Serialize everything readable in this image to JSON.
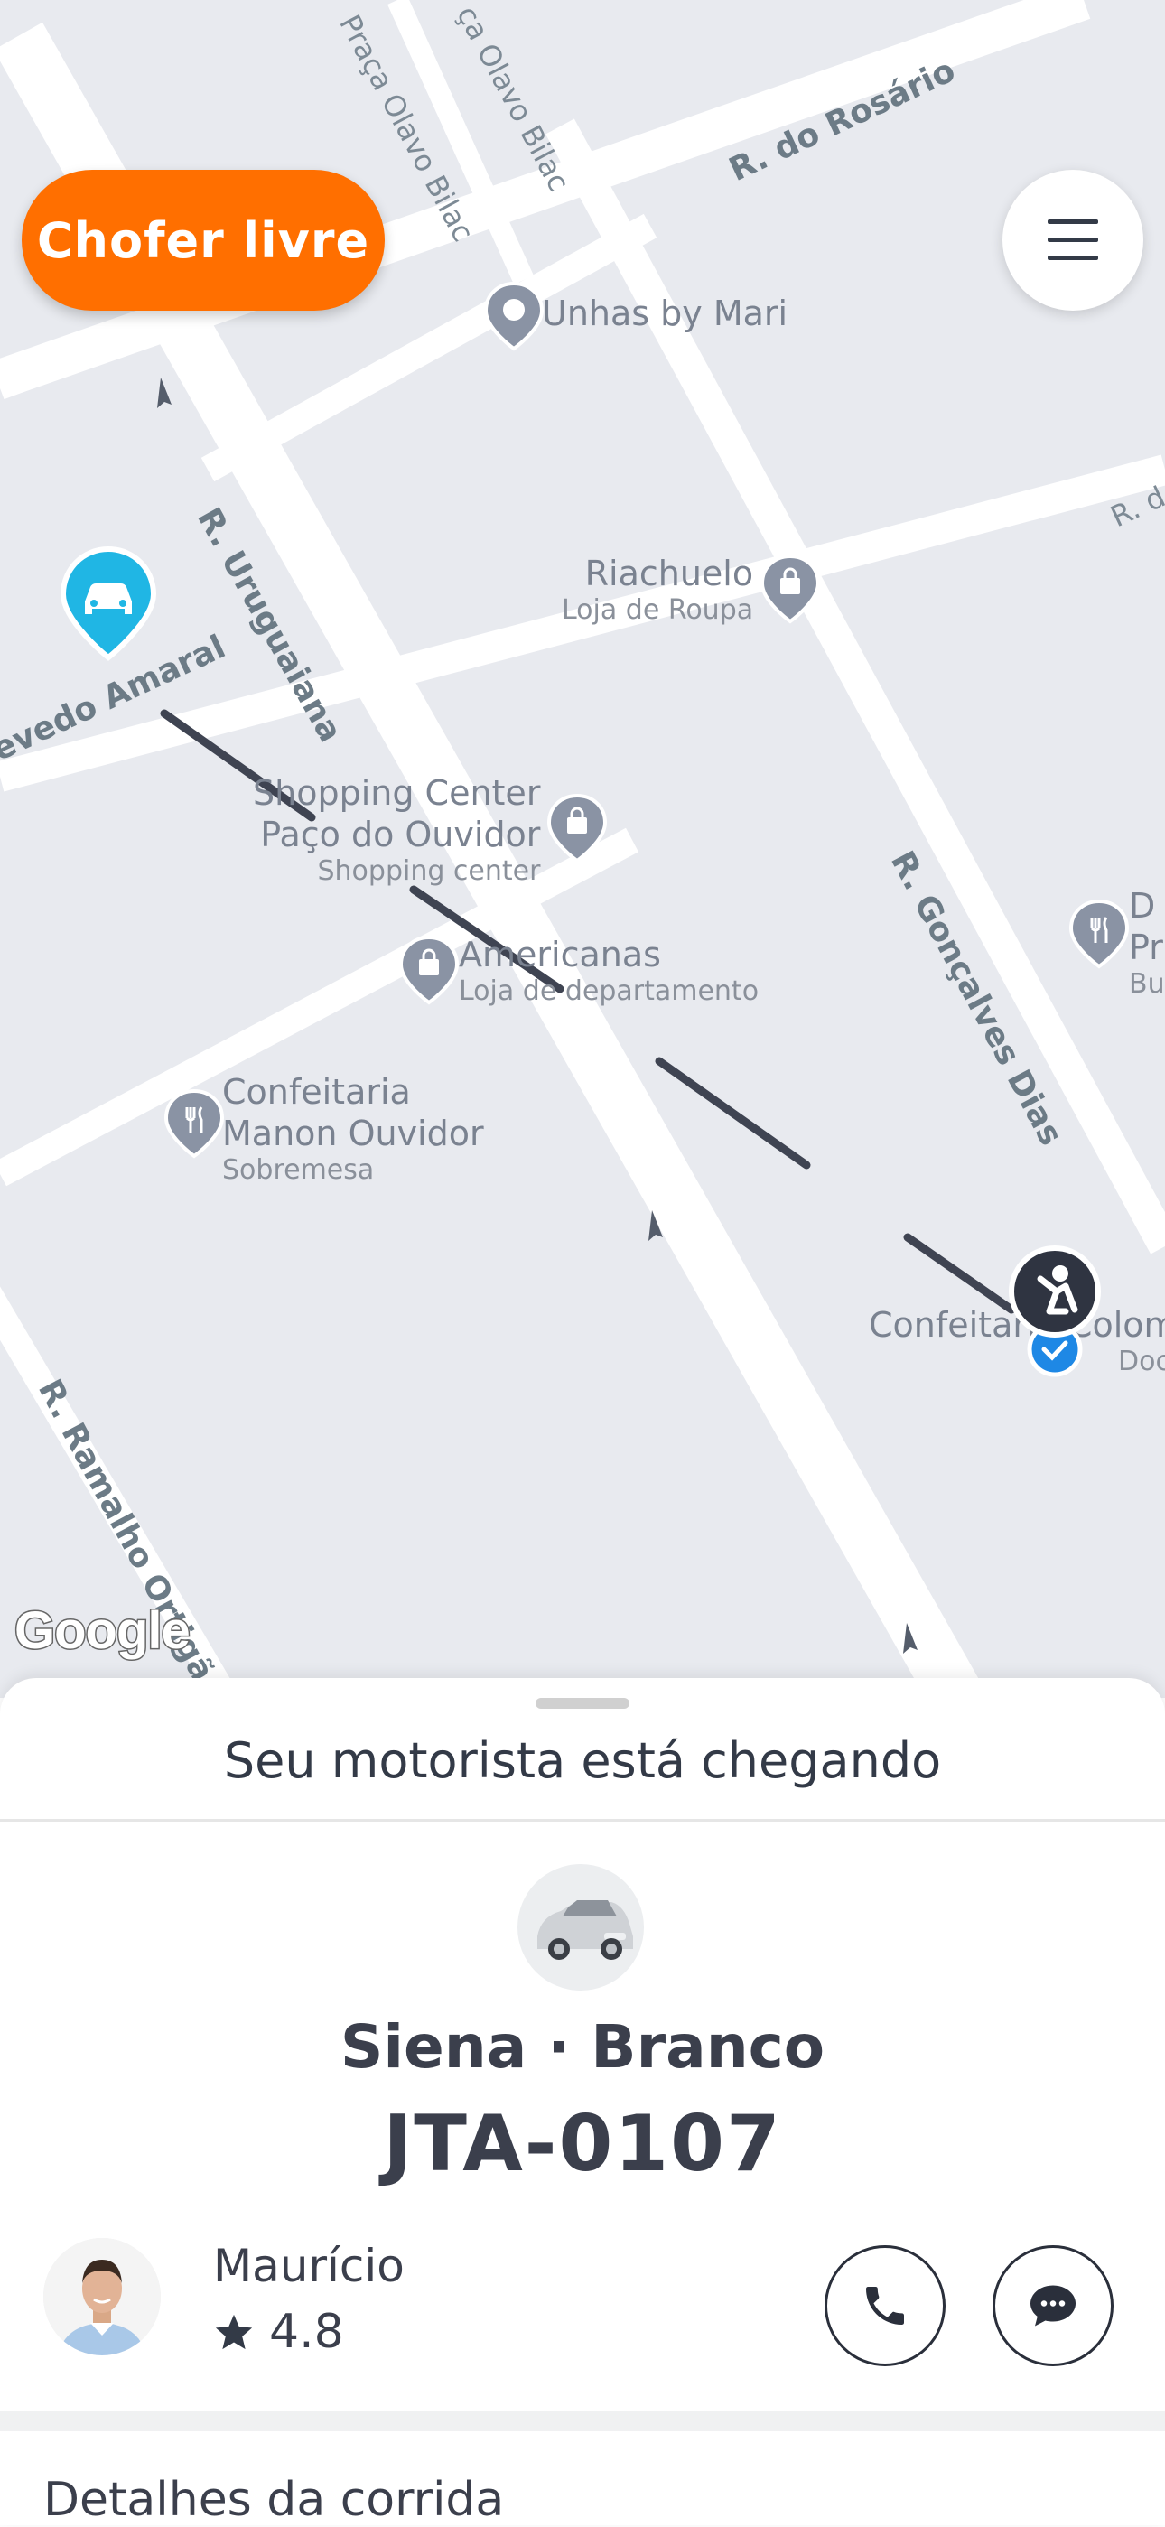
{
  "map": {
    "streets": {
      "praca_olavo_bilac_1": "Praça Olavo Bilac",
      "praca_olavo_bilac_2": "ça Olavo Bilac",
      "rosario": "R. do Rosário",
      "uruguaiana": "R. Uruguaiana",
      "amaral": "evedo Amaral",
      "goncalves_dias": "R. Gonçalves Dias",
      "ramalho_ortigao": "R. Ramalho Ortigão",
      "rd": "R. d"
    },
    "pois": {
      "unhas": {
        "name": "Unhas by Mari"
      },
      "riachuelo": {
        "name": "Riachuelo",
        "sub": "Loja de Roupa"
      },
      "shopping": {
        "name1": "Shopping Center",
        "name2": "Paço do Ouvidor",
        "sub": "Shopping center"
      },
      "americanas": {
        "name": "Americanas",
        "sub": "Loja de departamento"
      },
      "confeitaria_manon": {
        "name1": "Confeitaria",
        "name2": "Manon Ouvidor",
        "sub": "Sobremesa"
      },
      "confeitaria_colombo": {
        "name": "Confeitaria Colomb",
        "sub": "Doc"
      },
      "right_poi": {
        "name1": "D",
        "name2": "Pr",
        "sub": "Bu"
      }
    },
    "google_logo": "Google"
  },
  "chofer_button": {
    "label": "Chofer livre",
    "color": "#ff6f00"
  },
  "menu_icon": "hamburger-menu-icon",
  "sheet": {
    "title": "Seu motorista está chegando",
    "car_model": "Siena · Branco",
    "plate": "JTA-0107",
    "driver": {
      "name": "Maurício",
      "rating": "4.8"
    },
    "call_icon": "phone-icon",
    "chat_icon": "chat-icon",
    "details_title": "Detalhes da corrida"
  }
}
